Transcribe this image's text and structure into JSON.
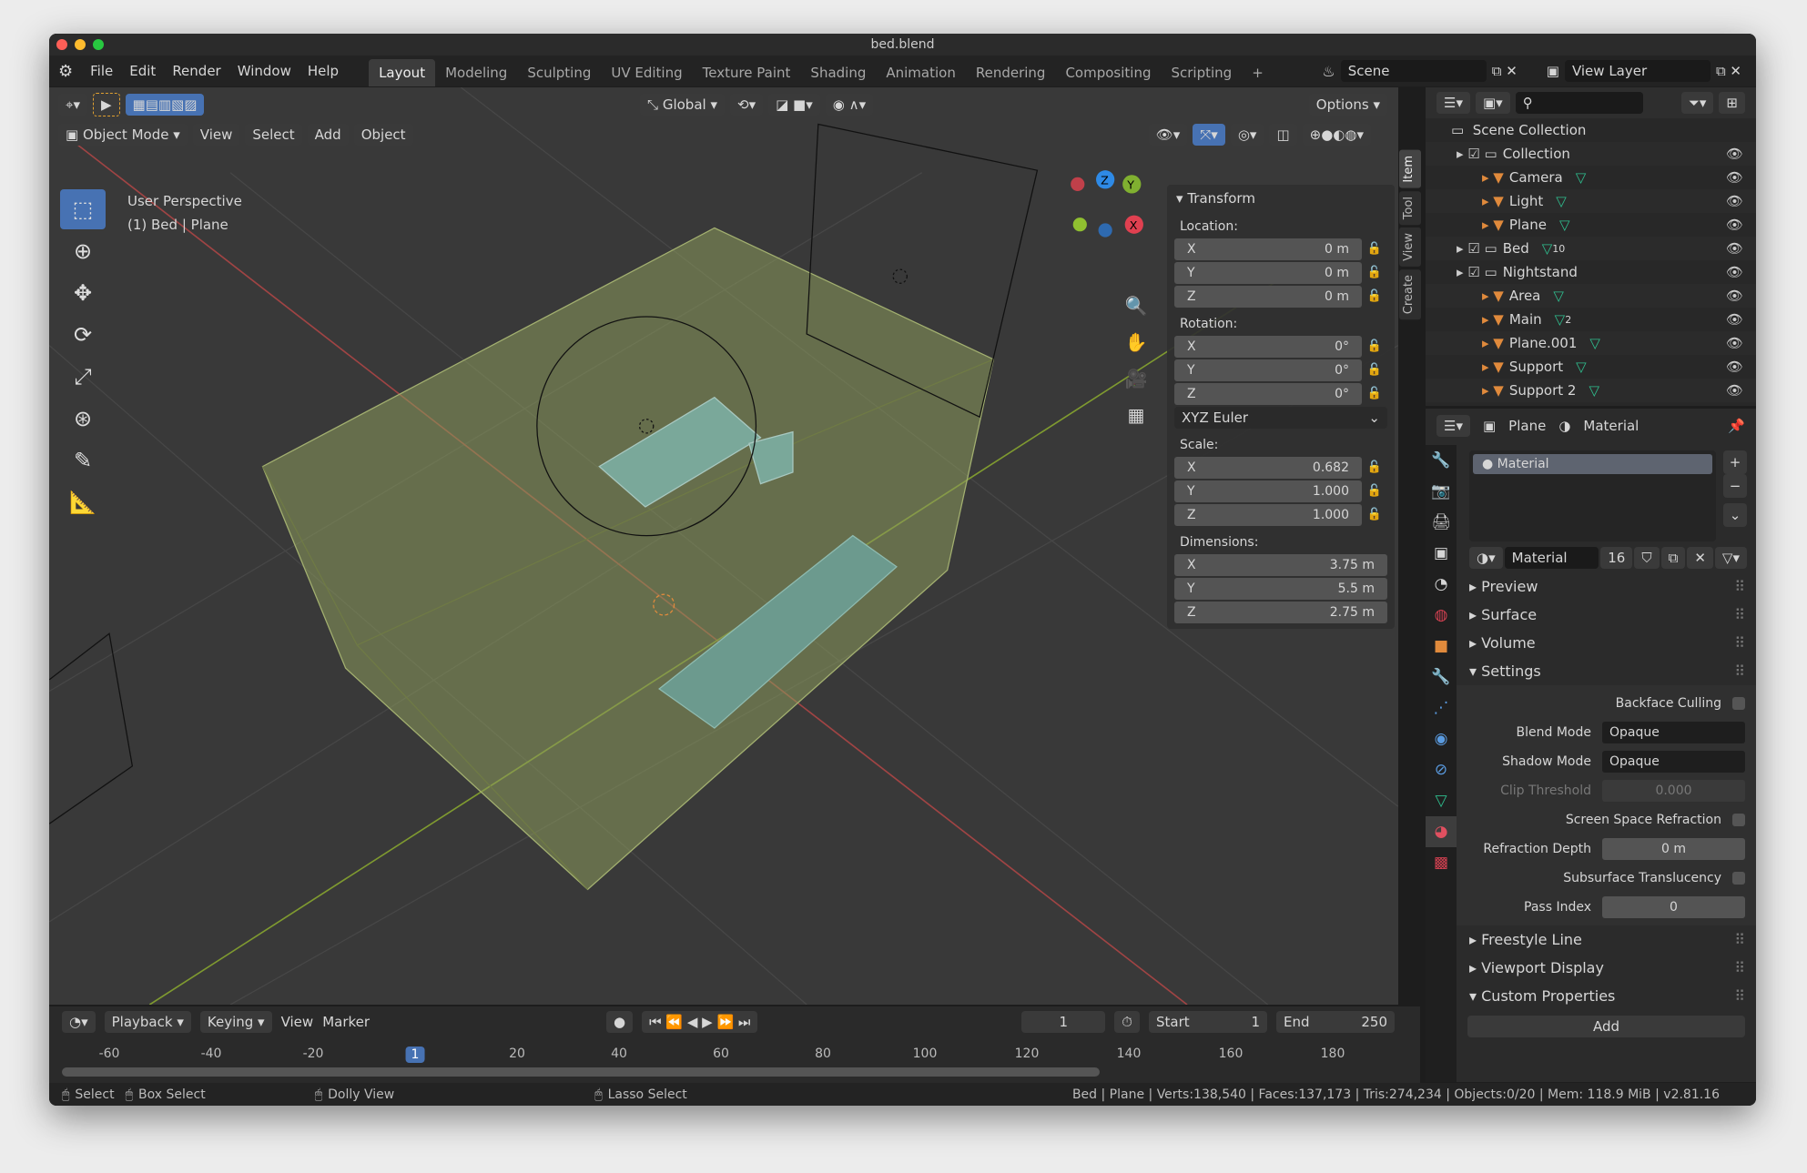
{
  "window": {
    "title": "bed.blend"
  },
  "menu": [
    "File",
    "Edit",
    "Render",
    "Window",
    "Help"
  ],
  "workspaces": [
    "Layout",
    "Modeling",
    "Sculpting",
    "UV Editing",
    "Texture Paint",
    "Shading",
    "Animation",
    "Rendering",
    "Compositing",
    "Scripting"
  ],
  "active_workspace": "Layout",
  "scene": "Scene",
  "view_layer": "View Layer",
  "tool_header": {
    "orientation": "Global",
    "options": "Options"
  },
  "viewport_header": {
    "mode": "Object Mode",
    "menus": [
      "View",
      "Select",
      "Add",
      "Object"
    ]
  },
  "viewport": {
    "perspective": "User Perspective",
    "selection": "(1) Bed | Plane",
    "gizmo_axes": [
      "X",
      "Y",
      "Z"
    ]
  },
  "npanel": {
    "title": "Transform",
    "location_label": "Location:",
    "location": [
      [
        "X",
        "0 m"
      ],
      [
        "Y",
        "0 m"
      ],
      [
        "Z",
        "0 m"
      ]
    ],
    "rotation_label": "Rotation:",
    "rotation": [
      [
        "X",
        "0°"
      ],
      [
        "Y",
        "0°"
      ],
      [
        "Z",
        "0°"
      ]
    ],
    "rotation_mode": "XYZ Euler",
    "scale_label": "Scale:",
    "scale": [
      [
        "X",
        "0.682"
      ],
      [
        "Y",
        "1.000"
      ],
      [
        "Z",
        "1.000"
      ]
    ],
    "dimensions_label": "Dimensions:",
    "dimensions": [
      [
        "X",
        "3.75 m"
      ],
      [
        "Y",
        "5.5 m"
      ],
      [
        "Z",
        "2.75 m"
      ]
    ],
    "tabs": [
      "Item",
      "Tool",
      "View",
      "Create"
    ]
  },
  "outliner": {
    "root": "Scene Collection",
    "items": [
      {
        "name": "Collection",
        "level": 0,
        "badge": ""
      },
      {
        "name": "Camera",
        "level": 1,
        "badge": ""
      },
      {
        "name": "Light",
        "level": 1,
        "badge": ""
      },
      {
        "name": "Plane",
        "level": 1,
        "badge": ""
      },
      {
        "name": "Bed",
        "level": 0,
        "badge": "10"
      },
      {
        "name": "Nightstand",
        "level": 0,
        "badge": ""
      },
      {
        "name": "Area",
        "level": 1,
        "badge": ""
      },
      {
        "name": "Main",
        "level": 1,
        "badge": "2"
      },
      {
        "name": "Plane.001",
        "level": 1,
        "badge": ""
      },
      {
        "name": "Support",
        "level": 1,
        "badge": ""
      },
      {
        "name": "Support 2",
        "level": 1,
        "badge": ""
      }
    ]
  },
  "properties": {
    "breadcrumb": [
      "Plane",
      "Material"
    ],
    "slot": "Material",
    "material_name": "Material",
    "users": "16",
    "sections_top": [
      "Preview",
      "Surface",
      "Volume",
      "Settings"
    ],
    "settings": {
      "backface_culling": "Backface Culling",
      "blend_mode_label": "Blend Mode",
      "blend_mode": "Opaque",
      "shadow_mode_label": "Shadow Mode",
      "shadow_mode": "Opaque",
      "clip_label": "Clip Threshold",
      "clip": "0.000",
      "ssr": "Screen Space Refraction",
      "refraction_label": "Refraction Depth",
      "refraction": "0 m",
      "subsurface": "Subsurface Translucency",
      "pass_label": "Pass Index",
      "pass": "0"
    },
    "sections_bottom": [
      "Freestyle Line",
      "Viewport Display",
      "Custom Properties"
    ],
    "add": "Add"
  },
  "timeline": {
    "menus": [
      "Playback",
      "Keying",
      "View",
      "Marker"
    ],
    "current": "1",
    "start_label": "Start",
    "start": "1",
    "end_label": "End",
    "end": "250",
    "ticks": [
      "-60",
      "-40",
      "-20",
      "1",
      "20",
      "40",
      "60",
      "80",
      "100",
      "120",
      "140",
      "160",
      "180"
    ]
  },
  "status": {
    "hints": [
      "Select",
      "Box Select",
      "Dolly View",
      "Lasso Select"
    ],
    "stats": "Bed | Plane | Verts:138,540 | Faces:137,173 | Tris:274,234 | Objects:0/20 | Mem: 118.9 MiB | v2.81.16"
  },
  "colors": {
    "accent": "#4772b3",
    "room": "#8c9a5c",
    "object_orange": "#e08a3c",
    "data_green": "#2fbf8f"
  }
}
